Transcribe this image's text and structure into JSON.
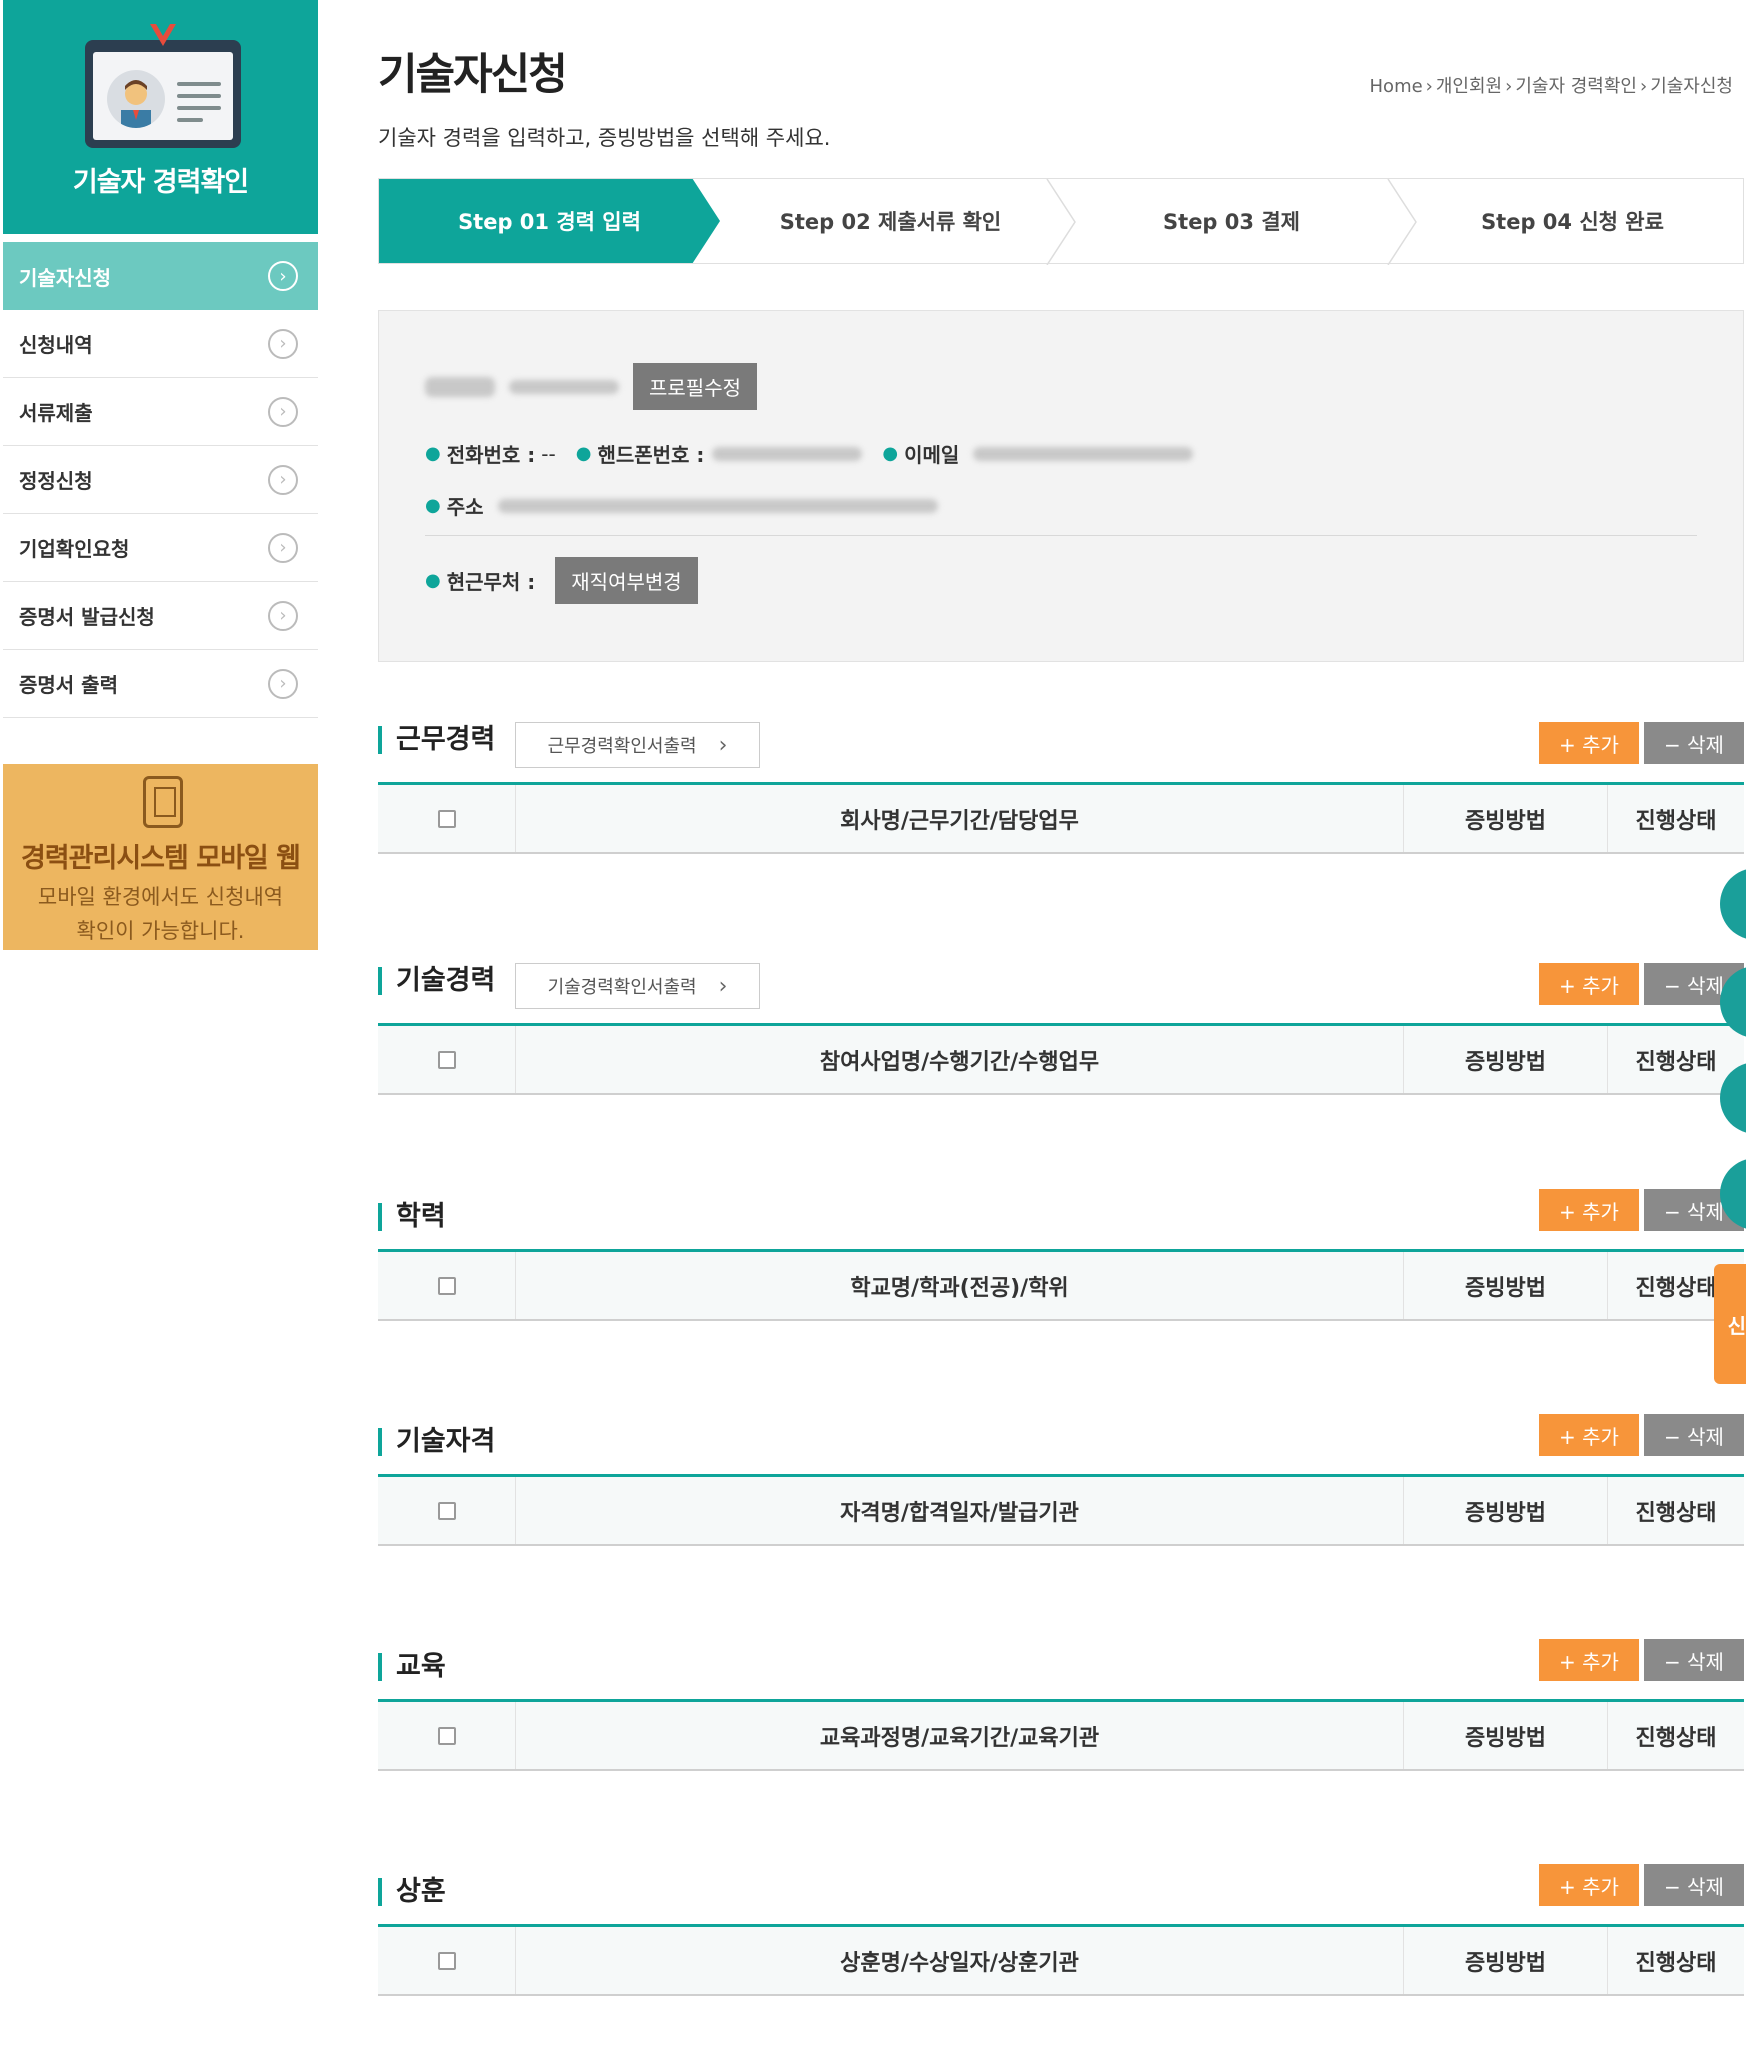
{
  "sidebar": {
    "title": "기술자 경력확인",
    "items": [
      {
        "label": "기술자신청",
        "active": true
      },
      {
        "label": "신청내역"
      },
      {
        "label": "서류제출"
      },
      {
        "label": "정정신청"
      },
      {
        "label": "기업확인요청"
      },
      {
        "label": "증명서 발급신청"
      },
      {
        "label": "증명서 출력"
      }
    ],
    "banner": {
      "title": "경력관리시스템 모바일 웹",
      "line1": "모바일 환경에서도 신청내역",
      "line2": "확인이 가능합니다."
    }
  },
  "page": {
    "title": "기술자신청",
    "subtitle": "기술자 경력을 입력하고, 증빙방법을 선택해 주세요.",
    "breadcrumb": [
      "Home",
      "개인회원",
      "기술자 경력확인",
      "기술자신청"
    ]
  },
  "steps": [
    {
      "label": "Step 01 경력 입력",
      "active": true
    },
    {
      "label": "Step 02 제출서류 확인"
    },
    {
      "label": "Step 03 결제"
    },
    {
      "label": "Step 04 신청 완료"
    }
  ],
  "profile": {
    "edit_button": "프로필수정",
    "phone_label": "전화번호 :",
    "phone_value": "--",
    "mobile_label": "핸드폰번호 :",
    "email_label": "이메일",
    "address_label": "주소",
    "workplace_label": "현근무처 :",
    "employment_button": "재직여부변경"
  },
  "common": {
    "add_label": "+ 추가",
    "delete_label": "− 삭제",
    "proof_header": "증빙방법",
    "status_header": "진행상태"
  },
  "sections": [
    {
      "title": "근무경력",
      "print_button": "근무경력확인서출력",
      "header": "회사명/근무기간/담당업무"
    },
    {
      "title": "기술경력",
      "print_button": "기술경력확인서출력",
      "header": "참여사업명/수행기간/수행업무"
    },
    {
      "title": "학력",
      "header": "학교명/학과(전공)/학위"
    },
    {
      "title": "기술자격",
      "header": "자격명/합격일자/발급기관"
    },
    {
      "title": "교육",
      "header": "교육과정명/교육기간/교육기관"
    },
    {
      "title": "상훈",
      "header": "상훈명/수상일자/상훈기관"
    }
  ],
  "floating_tab_label": "신",
  "colors": {
    "primary": "#0ea59a",
    "accent": "#f7953a",
    "gray_button": "#7a7a7a",
    "banner": "#edb660"
  }
}
